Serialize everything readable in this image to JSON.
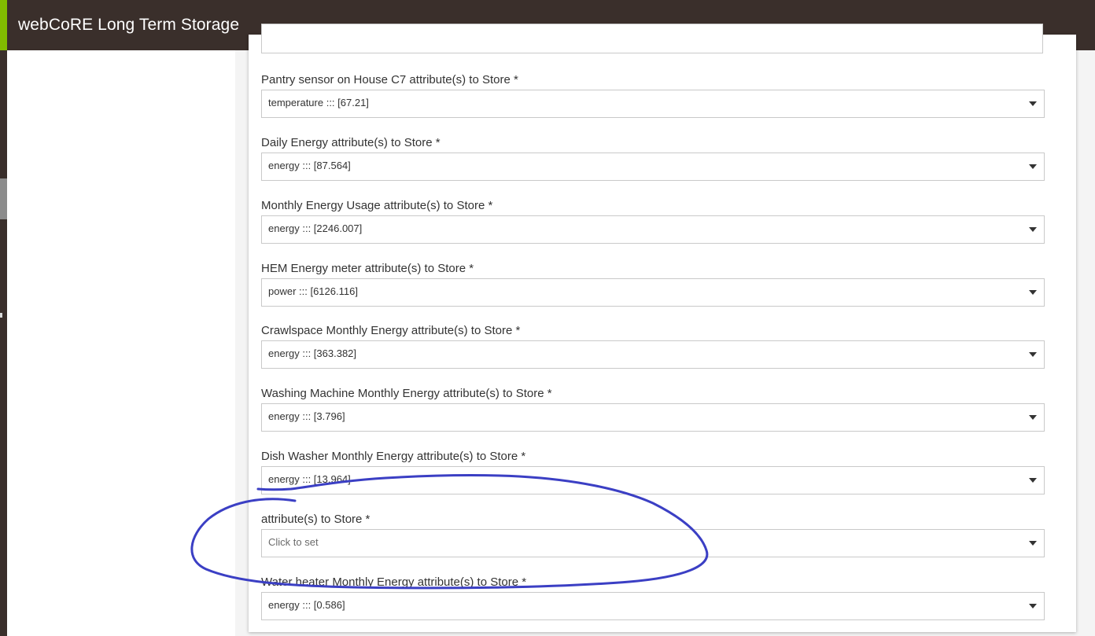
{
  "app": {
    "title": "webCoRE Long Term Storage"
  },
  "colors": {
    "topbar": "#3a2f2b",
    "accent": "#81bc00",
    "annotation": "#3b3fc4"
  },
  "form": {
    "fields": [
      {
        "label": "Pantry sensor on House C7 attribute(s) to Store *",
        "value": "temperature ::: [67.21]"
      },
      {
        "label": "Daily Energy attribute(s) to Store *",
        "value": "energy ::: [87.564]"
      },
      {
        "label": "Monthly Energy Usage attribute(s) to Store *",
        "value": "energy ::: [2246.007]"
      },
      {
        "label": "HEM Energy meter attribute(s) to Store *",
        "value": "power ::: [6126.116]"
      },
      {
        "label": "Crawlspace Monthly Energy attribute(s) to Store *",
        "value": "energy ::: [363.382]"
      },
      {
        "label": "Washing Machine Monthly Energy attribute(s) to Store *",
        "value": "energy ::: [3.796]"
      },
      {
        "label": "Dish Washer Monthly Energy attribute(s) to Store *",
        "value": "energy ::: [13.964]"
      },
      {
        "label": "attribute(s) to Store *",
        "value": "Click to set",
        "placeholder": true
      },
      {
        "label": "Water heater Monthly Energy attribute(s) to Store *",
        "value": "energy ::: [0.586]"
      }
    ]
  }
}
